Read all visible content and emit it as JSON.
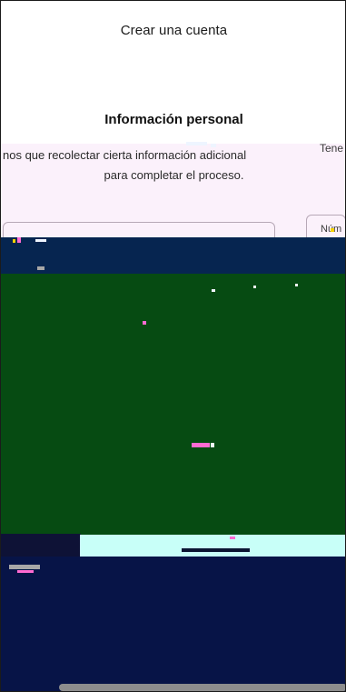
{
  "header": {
    "title": "Crear una cuenta"
  },
  "section": {
    "title": "Información personal"
  },
  "description": {
    "line1": "nos que recolectar cierta información adicional",
    "line2": "para completar el proceso."
  },
  "right_panel_peek": {
    "text": "Tene",
    "field_peek": "Núm"
  },
  "colors": {
    "background": "#ffffff",
    "pink_band": "#fbf1fb",
    "blue_bar": "#062550",
    "green_block": "#064b12",
    "teal_strip": "#c8fff8",
    "navy_block": "#071447",
    "home_indicator": "#8d8d8d"
  }
}
